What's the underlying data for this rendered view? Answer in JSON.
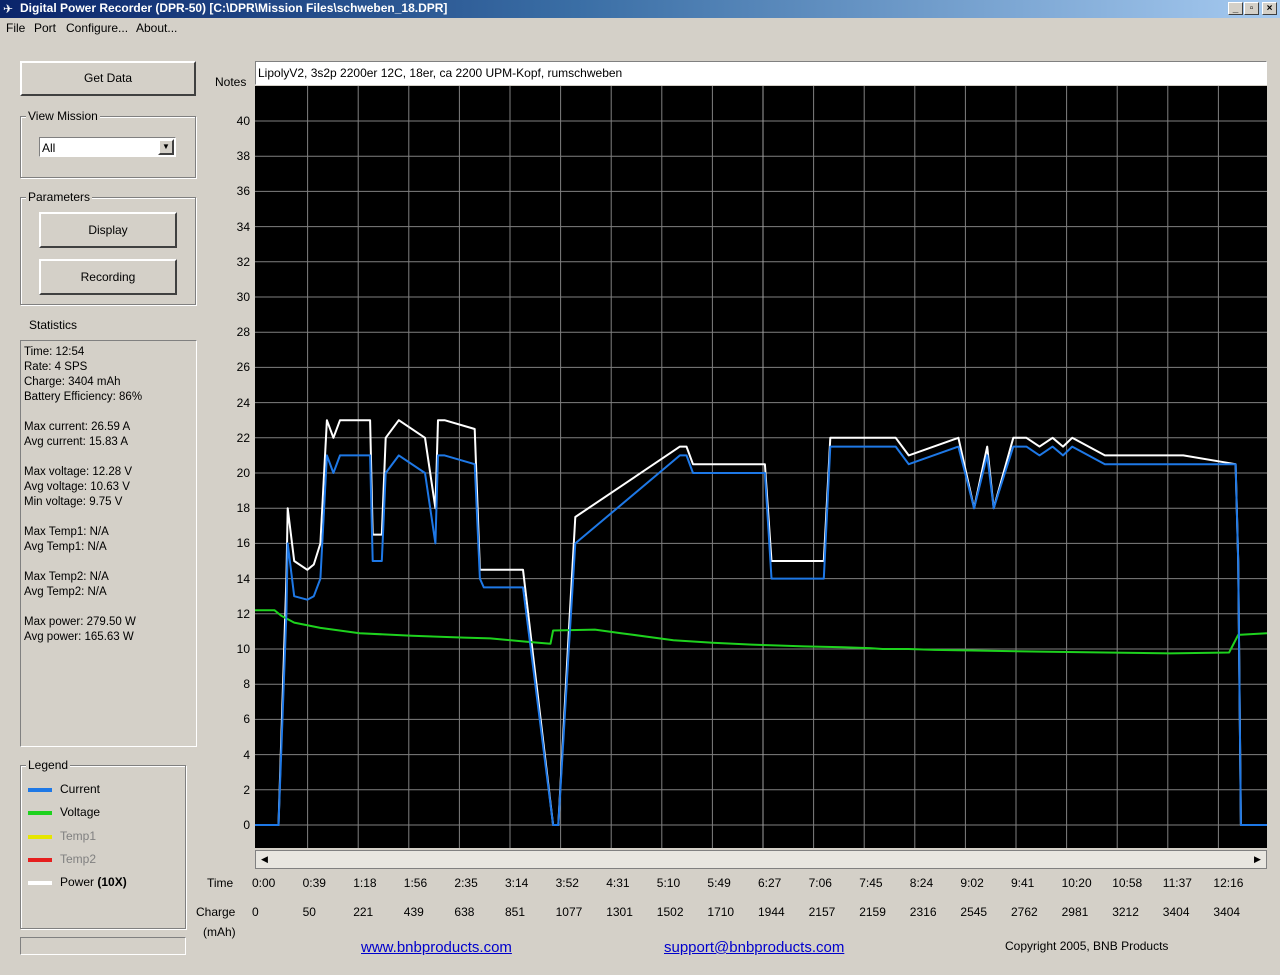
{
  "window": {
    "title": "Digital Power Recorder (DPR-50) [C:\\DPR\\Mission Files\\schweben_18.DPR]"
  },
  "menu": [
    "File",
    "Port",
    "Configure...",
    "About..."
  ],
  "controls": {
    "get_data": "Get Data",
    "view_mission_label": "View Mission",
    "view_mission_value": "All",
    "parameters_label": "Parameters",
    "display": "Display",
    "recording": "Recording",
    "statistics_label": "Statistics"
  },
  "statistics": [
    "Time: 12:54",
    "Rate: 4 SPS",
    "Charge: 3404 mAh",
    "Battery Efficiency: 86%",
    "",
    "Max current: 26.59 A",
    "Avg current: 15.83 A",
    "",
    "Max voltage: 12.28 V",
    "Avg voltage: 10.63 V",
    "Min voltage: 9.75 V",
    "",
    "Max Temp1: N/A",
    "Avg Temp1: N/A",
    "",
    "Max Temp2: N/A",
    "Avg Temp2: N/A",
    "",
    "Max power: 279.50 W",
    "Avg power: 165.63 W"
  ],
  "legend": {
    "label": "Legend",
    "items": [
      {
        "name": "Current",
        "color": "#1e78e6",
        "enabled": true
      },
      {
        "name": "Voltage",
        "color": "#1ed21e",
        "enabled": true
      },
      {
        "name": "Temp1",
        "color": "#e6e600",
        "enabled": false
      },
      {
        "name": "Temp2",
        "color": "#e61e1e",
        "enabled": false
      },
      {
        "name": "Power",
        "suffix": "(10X)",
        "color": "#ffffff",
        "enabled": true
      }
    ]
  },
  "notes": {
    "label": "Notes",
    "value": "LipolyV2, 3s2p 2200er 12C, 18er, ca 2200 UPM-Kopf, rumschweben"
  },
  "axis": {
    "time_label": "Time",
    "charge_label": "Charge",
    "charge_unit": "(mAh)"
  },
  "footer": {
    "website": "www.bnbproducts.com",
    "support": "support@bnbproducts.com",
    "copyright": "Copyright 2005, BNB Products"
  },
  "chart_data": {
    "type": "line",
    "ylim": [
      0,
      42
    ],
    "yticks": [
      0,
      2,
      4,
      6,
      8,
      10,
      12,
      14,
      16,
      18,
      20,
      22,
      24,
      26,
      28,
      30,
      32,
      34,
      36,
      38,
      40
    ],
    "xlim": [
      0,
      774
    ],
    "x_unit": "seconds",
    "time_ticks": [
      "0:00",
      "0:39",
      "1:18",
      "1:56",
      "2:35",
      "3:14",
      "3:52",
      "4:31",
      "5:10",
      "5:49",
      "6:27",
      "7:06",
      "7:45",
      "8:24",
      "9:02",
      "9:41",
      "10:20",
      "10:58",
      "11:37",
      "12:16"
    ],
    "charge_ticks": [
      "0",
      "50",
      "221",
      "439",
      "638",
      "851",
      "1077",
      "1301",
      "1502",
      "1710",
      "1944",
      "2157",
      "2159",
      "2316",
      "2545",
      "2762",
      "2981",
      "3212",
      "3404",
      "3404"
    ],
    "grid": true,
    "series": [
      {
        "name": "Current",
        "color": "#1e78e6",
        "x": [
          0,
          15,
          18,
          24,
          25,
          30,
          40,
          45,
          50,
          55,
          60,
          65,
          88,
          90,
          97,
          100,
          110,
          130,
          138,
          140,
          145,
          168,
          172,
          175,
          205,
          228,
          232,
          240,
          245,
          325,
          330,
          335,
          390,
          395,
          435,
          440,
          490,
          500,
          538,
          550,
          560,
          565,
          580,
          590,
          600,
          610,
          618,
          625,
          650,
          680,
          700,
          710,
          750,
          752,
          754,
          774
        ],
        "y": [
          0,
          0,
          0,
          12,
          16,
          13,
          12.8,
          13,
          14,
          21,
          20,
          21,
          21,
          15,
          15,
          20,
          21,
          20,
          16,
          21,
          21,
          20.5,
          14,
          13.5,
          13.5,
          0,
          0,
          10,
          16,
          21,
          21,
          20,
          20,
          14,
          14,
          21.5,
          21.5,
          20.5,
          21.5,
          18,
          21,
          18,
          21.5,
          21.5,
          21,
          21.5,
          21,
          21.5,
          20.5,
          20.5,
          20.5,
          20.5,
          20.5,
          15,
          0,
          0
        ]
      },
      {
        "name": "Voltage",
        "color": "#1ed21e",
        "x": [
          0,
          15,
          20,
          30,
          50,
          80,
          120,
          160,
          180,
          210,
          226,
          228,
          260,
          280,
          320,
          350,
          380,
          400,
          420,
          450,
          470,
          480,
          500,
          520,
          560,
          600,
          650,
          700,
          745,
          752,
          774
        ],
        "y": [
          12.2,
          12.2,
          11.9,
          11.5,
          11.2,
          10.9,
          10.75,
          10.65,
          10.6,
          10.4,
          10.3,
          11.05,
          11.1,
          10.9,
          10.5,
          10.35,
          10.25,
          10.2,
          10.15,
          10.1,
          10.05,
          10.0,
          10.0,
          9.95,
          9.9,
          9.85,
          9.8,
          9.75,
          9.8,
          10.8,
          10.9
        ]
      },
      {
        "name": "Power",
        "color": "#ffffff",
        "x": [
          0,
          15,
          18,
          24,
          25,
          30,
          40,
          45,
          50,
          55,
          60,
          65,
          88,
          90,
          97,
          100,
          110,
          130,
          138,
          140,
          145,
          168,
          172,
          175,
          205,
          228,
          232,
          240,
          245,
          325,
          330,
          335,
          390,
          395,
          435,
          440,
          490,
          500,
          538,
          550,
          560,
          565,
          580,
          590,
          600,
          610,
          618,
          625,
          650,
          680,
          700,
          710,
          750,
          752,
          754,
          774
        ],
        "y": [
          0,
          0,
          0,
          14,
          18,
          15,
          14.5,
          14.8,
          16,
          23,
          22,
          23,
          23,
          16.5,
          16.5,
          22,
          23,
          22,
          18,
          23,
          23,
          22.5,
          14.5,
          14.5,
          14.5,
          0,
          0,
          11,
          17.5,
          21.5,
          21.5,
          20.5,
          20.5,
          15,
          15,
          22,
          22,
          21,
          22,
          18,
          21.5,
          18,
          22,
          22,
          21.5,
          22,
          21.5,
          22,
          21,
          21,
          21,
          21,
          20.5,
          15,
          0,
          0
        ]
      }
    ]
  }
}
